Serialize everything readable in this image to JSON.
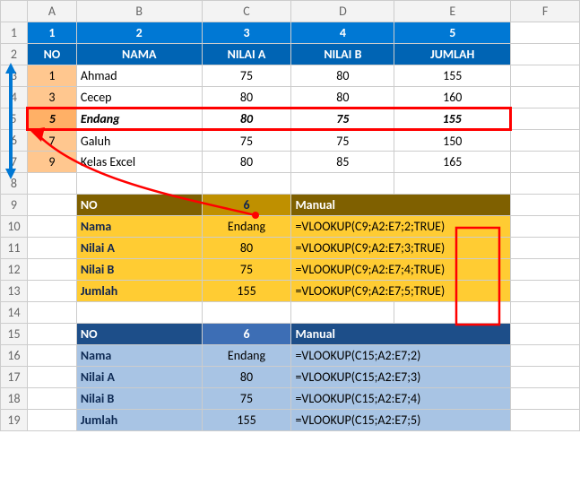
{
  "columns": [
    "A",
    "B",
    "C",
    "D",
    "E",
    "F"
  ],
  "row_numbers": [
    "1",
    "2",
    "3",
    "4",
    "5",
    "6",
    "7",
    "8",
    "9",
    "10",
    "11",
    "12",
    "13",
    "14",
    "15",
    "16",
    "17",
    "18",
    "19"
  ],
  "header_numbers": {
    "A": "1",
    "B": "2",
    "C": "3",
    "D": "4",
    "E": "5"
  },
  "table_headers": {
    "no": "NO",
    "nama": "NAMA",
    "nilaiA": "NILAI A",
    "nilaiB": "NILAI B",
    "jumlah": "JUMLAH"
  },
  "rows": [
    {
      "no": "1",
      "nama": "Ahmad",
      "a": "75",
      "b": "80",
      "j": "155"
    },
    {
      "no": "3",
      "nama": "Cecep",
      "a": "80",
      "b": "80",
      "j": "160"
    },
    {
      "no": "5",
      "nama": "Endang",
      "a": "80",
      "b": "75",
      "j": "155"
    },
    {
      "no": "7",
      "nama": "Galuh",
      "a": "75",
      "b": "75",
      "j": "150"
    },
    {
      "no": "9",
      "nama": "Kelas Excel",
      "a": "80",
      "b": "85",
      "j": "165"
    }
  ],
  "yellow": {
    "hdr_no": "NO",
    "hdr_val": "6",
    "hdr_manual": "Manual",
    "lbl_nama": "Nama",
    "val_nama": "Endang",
    "f_nama": "=VLOOKUP(C9;A2:E7;2;TRUE)",
    "lbl_a": "Nilai A",
    "val_a": "80",
    "f_a": "=VLOOKUP(C9;A2:E7;3;TRUE)",
    "lbl_b": "Nilai B",
    "val_b": "75",
    "f_b": "=VLOOKUP(C9;A2:E7;4;TRUE)",
    "lbl_j": "Jumlah",
    "val_j": "155",
    "f_j": "=VLOOKUP(C9;A2:E7;5;TRUE)"
  },
  "blue": {
    "hdr_no": "NO",
    "hdr_val": "6",
    "hdr_manual": "Manual",
    "lbl_nama": "Nama",
    "val_nama": "Endang",
    "f_nama": "=VLOOKUP(C15;A2:E7;2)",
    "lbl_a": "Nilai A",
    "val_a": "80",
    "f_a": "=VLOOKUP(C15;A2:E7;3)",
    "lbl_b": "Nilai B",
    "val_b": "75",
    "f_b": "=VLOOKUP(C15;A2:E7;4)",
    "lbl_j": "Jumlah",
    "val_j": "155",
    "f_j": "=VLOOKUP(C15;A2:E7;5)"
  },
  "chart_data": {
    "type": "table",
    "title": "VLOOKUP approximate match example",
    "top_table": {
      "columns": [
        "NO",
        "NAMA",
        "NILAI A",
        "NILAI B",
        "JUMLAH"
      ],
      "rows": [
        [
          1,
          "Ahmad",
          75,
          80,
          155
        ],
        [
          3,
          "Cecep",
          80,
          80,
          160
        ],
        [
          5,
          "Endang",
          80,
          75,
          155
        ],
        [
          7,
          "Galuh",
          75,
          75,
          150
        ],
        [
          9,
          "Kelas Excel",
          80,
          85,
          165
        ]
      ],
      "highlighted_row_index": 2
    },
    "lookups": [
      {
        "color": "yellow",
        "key": 6,
        "results": {
          "Nama": "Endang",
          "Nilai A": 80,
          "Nilai B": 75,
          "Jumlah": 155
        },
        "formulas": {
          "Nama": "=VLOOKUP(C9;A2:E7;2;TRUE)",
          "Nilai A": "=VLOOKUP(C9;A2:E7;3;TRUE)",
          "Nilai B": "=VLOOKUP(C9;A2:E7;4;TRUE)",
          "Jumlah": "=VLOOKUP(C9;A2:E7;5;TRUE)"
        }
      },
      {
        "color": "blue",
        "key": 6,
        "results": {
          "Nama": "Endang",
          "Nilai A": 80,
          "Nilai B": 75,
          "Jumlah": 155
        },
        "formulas": {
          "Nama": "=VLOOKUP(C15;A2:E7;2)",
          "Nilai A": "=VLOOKUP(C15;A2:E7;3)",
          "Nilai B": "=VLOOKUP(C15;A2:E7;4)",
          "Jumlah": "=VLOOKUP(C15;A2:E7;5)"
        }
      }
    ]
  }
}
